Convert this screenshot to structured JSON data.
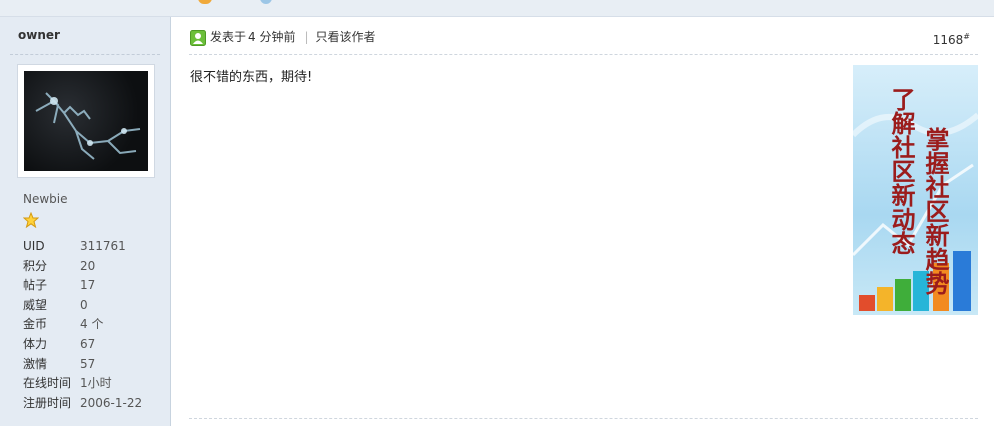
{
  "author": {
    "name": "owner",
    "rank": "Newbie",
    "stats": [
      {
        "label": "UID",
        "value": "311761"
      },
      {
        "label": "积分",
        "value": "20"
      },
      {
        "label": "帖子",
        "value": "17"
      },
      {
        "label": "威望",
        "value": "0"
      },
      {
        "label": "金币",
        "value": "4 个"
      },
      {
        "label": "体力",
        "value": "67"
      },
      {
        "label": "激情",
        "value": "57"
      },
      {
        "label": "在线时间",
        "value": "1小时"
      },
      {
        "label": "注册时间",
        "value": "2006-1-22"
      }
    ]
  },
  "post": {
    "posted_prefix": "发表于",
    "time": "4 分钟前",
    "view_author_only": "只看该作者",
    "floor": "1168",
    "floor_mark": "#",
    "content": "很不错的东西，期待!"
  },
  "ad": {
    "line1": "了解社区新动态",
    "line2": "掌握社区新趋势"
  },
  "colors": {
    "sidebar_bg": "#e4ebf3",
    "online_icon": "#6cbf3a",
    "ad_text": "#9b1c1c"
  }
}
